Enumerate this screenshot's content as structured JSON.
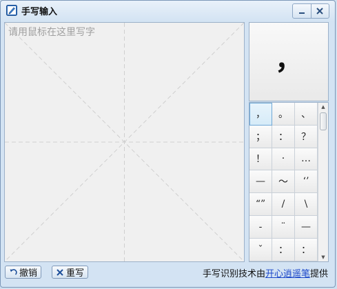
{
  "window": {
    "title": "手写输入",
    "minimize_icon": "minimize-icon",
    "close_icon": "close-icon"
  },
  "canvas": {
    "placeholder": "请用鼠标在这里写字"
  },
  "preview": {
    "character": "，"
  },
  "symbols": [
    "，",
    "。",
    "、",
    "；",
    "：",
    "？",
    "！",
    "·",
    "…",
    "—",
    "～",
    "‘’",
    "“”",
    "/",
    "\\",
    "-",
    "¨",
    "—",
    "ˇ",
    "：",
    "："
  ],
  "selected_symbol_index": 0,
  "buttons": {
    "undo_label": "撤销",
    "undo_icon": "undo-arrow-icon",
    "rewrite_label": "重写",
    "rewrite_icon": "x-icon"
  },
  "footer": {
    "prefix": "手写识别技术由",
    "link": "开心逍遥笔",
    "suffix": "提供"
  },
  "colors": {
    "link": "#1b47c9",
    "frame": "#d3e3f3",
    "border": "#7b97b8"
  }
}
